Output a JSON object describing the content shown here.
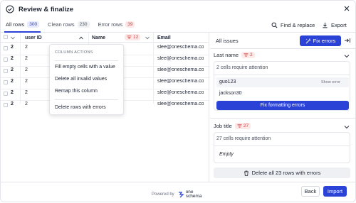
{
  "header": {
    "title": "Review & finalize"
  },
  "tabs": [
    {
      "label": "All rows",
      "count": "300"
    },
    {
      "label": "Clean rows",
      "count": "230"
    },
    {
      "label": "Error rows",
      "count": "39"
    }
  ],
  "toolbar": {
    "find_replace": "Find & replace",
    "export": "Export"
  },
  "grid": {
    "columns": [
      {
        "label": "user ID"
      },
      {
        "label": "Name",
        "error_count": "12"
      },
      {
        "label": "Email"
      }
    ],
    "rows": [
      {
        "num": "2",
        "user_id": "2",
        "email": "slee@oneschema.co"
      },
      {
        "num": "2",
        "user_id": "2",
        "email": "slee@oneschema.co"
      },
      {
        "num": "2",
        "user_id": "2",
        "email": "slee@oneschema.co"
      },
      {
        "num": "2",
        "user_id": "2",
        "email": "slee@oneschema.co"
      },
      {
        "num": "2",
        "user_id": "2",
        "email": "slee@oneschema.co"
      },
      {
        "num": "2",
        "user_id": "2",
        "email": "slee@oneschema.co"
      }
    ]
  },
  "column_menu": {
    "heading": "COLUMN ACTIONS",
    "items": [
      "Fill empty cells with a value",
      "Delete all invalid values",
      "Remap this column",
      "Delete rows with errors"
    ]
  },
  "issues_panel": {
    "title": "All issues",
    "fix_errors": "Fix errors",
    "cards": [
      {
        "name": "Last name",
        "count": "2",
        "summary": "2 cells require attention",
        "values": [
          "guo123",
          "jackson30"
        ],
        "show_error": "Show error",
        "action": "Fix formatting errors"
      },
      {
        "name": "Job title",
        "count": "27",
        "summary": "27 cells require attention",
        "values": [
          "Empty"
        ]
      }
    ],
    "delete_all": "Delete all 23 rows with errors"
  },
  "footer": {
    "powered_by": "Powered by",
    "brand_line1": "one",
    "brand_line2": "schema",
    "back": "Back",
    "import": "Import"
  },
  "colors": {
    "accent": "#2b42d6",
    "error": "#d23b3b"
  }
}
